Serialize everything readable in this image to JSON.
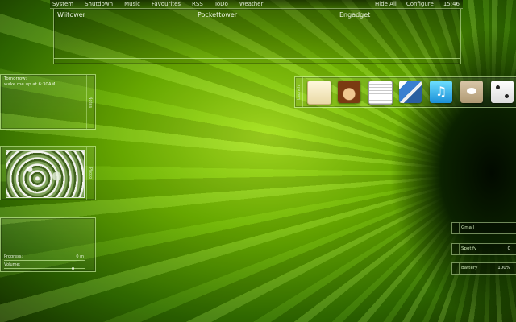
{
  "topbar": {
    "menu": [
      "System",
      "Shutdown",
      "Music",
      "Favourites",
      "RSS",
      "ToDo",
      "Weather"
    ],
    "hide_all": "Hide All",
    "configure": "Configure",
    "clock": "15:46"
  },
  "feeds": {
    "columns": [
      "Wiitower",
      "Pockettower",
      "Engadget"
    ]
  },
  "todo": {
    "line1": "Tomorrow:",
    "line2": "wake me up at 6:30AM",
    "tab": "Notes"
  },
  "photo": {
    "tab": "Photo"
  },
  "player": {
    "progress_label": "Progress:",
    "progress_value": "0 m",
    "volume_label": "Volume:",
    "progress": 0.0,
    "volume": 0.85
  },
  "dock": {
    "label": "Launch",
    "icons": [
      "notepad-icon",
      "monkey-icon",
      "notes-icon",
      "photos-icon",
      "music-note-icon",
      "speech-bubble-icon",
      "dice-icon"
    ]
  },
  "mini_widgets": [
    {
      "key": "Gmail",
      "value": ""
    },
    {
      "key": "Spotify",
      "value": "0"
    },
    {
      "key": "Battery",
      "value": "100%"
    }
  ]
}
